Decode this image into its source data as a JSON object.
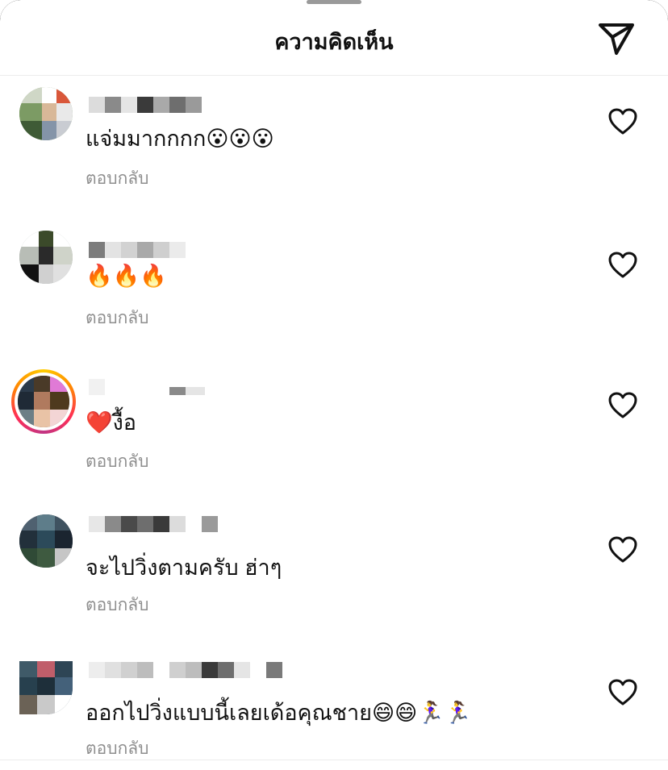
{
  "header": {
    "title": "ความคิดเห็น",
    "share_icon": "paper-plane-icon"
  },
  "comments": [
    {
      "text": "แจ่มมากกกก😮😮😮",
      "reply_label": "ตอบกลับ",
      "like_icon": "heart-outline-icon"
    },
    {
      "text": "🔥🔥🔥",
      "reply_label": "ตอบกลับ",
      "like_icon": "heart-outline-icon"
    },
    {
      "text": "❤️งื้อ",
      "reply_label": "ตอบกลับ",
      "like_icon": "heart-outline-icon"
    },
    {
      "text": "จะไปวิ่งตามครับ ฮ่าๆ",
      "reply_label": "ตอบกลับ",
      "like_icon": "heart-outline-icon"
    },
    {
      "text": "ออกไปวิ่งแบบนี้เลยเด้อคุณชาย😄😄🏃‍♀️🏃‍♀️",
      "reply_label": "ตอบกลับ",
      "like_icon": "heart-outline-icon"
    }
  ],
  "colors": {
    "secondary_text": "#8e8e8e",
    "divider": "#ececec",
    "story_ring": [
      "#ffcc00",
      "#ff2d55",
      "#c13584"
    ]
  }
}
